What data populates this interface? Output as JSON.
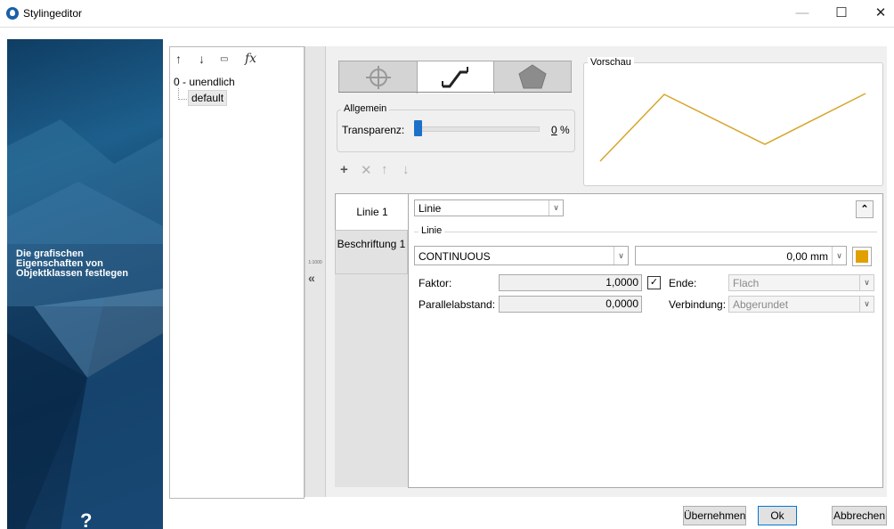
{
  "window": {
    "title": "Stylingeditor",
    "minimize": "—",
    "maximize": "☐",
    "close": "✕"
  },
  "sidebar": {
    "caption_lines": [
      "Die grafischen",
      "Eigenschaften von",
      "Objektklassen festlegen"
    ],
    "help": "?"
  },
  "tree": {
    "toolbar": [
      "↑",
      "↓",
      "▭",
      "fx"
    ],
    "root_label": "0 - unendlich",
    "item_label": "default"
  },
  "splitter": {
    "mini_label": "1:1000",
    "collapse_glyph": "«"
  },
  "style_tabs": [
    "point-symbol-icon",
    "line-symbol-icon",
    "area-symbol-icon"
  ],
  "general": {
    "legend": "Allgemein",
    "transparency_label": "Transparenz:",
    "transparency_value": "0",
    "transparency_unit": "%",
    "transparency_level": 0
  },
  "layer_toolbar": [
    "+",
    "✕",
    "↑",
    "↓"
  ],
  "preview": {
    "legend": "Vorschau",
    "line_color": "#d6a52a"
  },
  "sections": {
    "tabs": [
      "Linie 1",
      "Beschriftung 1"
    ],
    "type_value": "Linie",
    "subgroup_legend": "Linie",
    "linetype_value": "CONTINUOUS",
    "width_value": "0,00 mm",
    "line_color": "#e0a000",
    "factor_label": "Faktor:",
    "factor_value": "1,0000",
    "end_label": "Ende:",
    "end_value": "Flach",
    "parallel_label": "Parallelabstand:",
    "parallel_value": "0,0000",
    "join_label": "Verbindung:",
    "join_value": "Abgerundet",
    "collapse_glyph": "⌃"
  },
  "buttons": {
    "apply": "Übernehmen",
    "ok": "Ok",
    "cancel": "Abbrechen"
  }
}
